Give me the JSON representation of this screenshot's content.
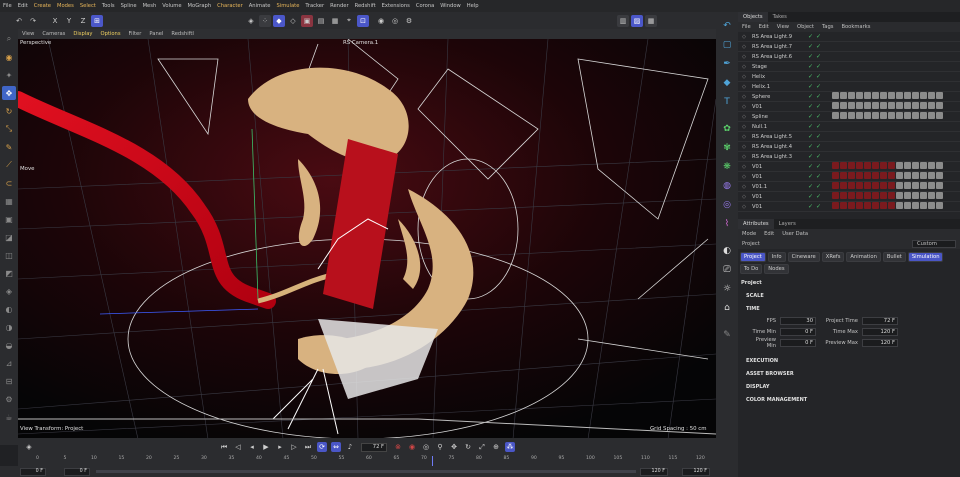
{
  "menu": [
    "File",
    "Edit",
    "Create",
    "Modes",
    "Select",
    "Tools",
    "Spline",
    "Mesh",
    "Volume",
    "MoGraph",
    "Character",
    "Animate",
    "Simulate",
    "Tracker",
    "Render",
    "Redshift",
    "Extensions",
    "Corona",
    "Window",
    "Help"
  ],
  "toolbar": {
    "axis_x": "X",
    "axis_y": "Y",
    "axis_z": "Z"
  },
  "viewport": {
    "menu": [
      "View",
      "Cameras",
      "Display",
      "Options",
      "Filter",
      "Panel",
      "RedshiftI"
    ],
    "title": "Perspective",
    "camera": "RS Camera.1",
    "tool_label": "Move",
    "view_transform": "View Transform: Project",
    "grid_spacing": "Grid Spacing : 50 cm"
  },
  "timeline": {
    "current_frame": "72 F"
  },
  "ruler": {
    "ticks": [
      "0",
      "5",
      "10",
      "15",
      "20",
      "25",
      "30",
      "35",
      "40",
      "45",
      "50",
      "55",
      "60",
      "65",
      "70",
      "75",
      "80",
      "85",
      "90",
      "95",
      "100",
      "105",
      "110",
      "115",
      "120"
    ],
    "cursor_frame": 72
  },
  "range": {
    "start": "0 F",
    "start2": "0 F",
    "end": "120 F",
    "end2": "120 F"
  },
  "objects": {
    "tabs": [
      "Objects",
      "Takes"
    ],
    "menu": [
      "File",
      "Edit",
      "View",
      "Object",
      "Tags",
      "Bookmarks"
    ],
    "rows": [
      {
        "name": "RS Area Light.9"
      },
      {
        "name": "RS Area Light.7"
      },
      {
        "name": "RS Area Light.6"
      },
      {
        "name": "Stage"
      },
      {
        "name": "Helix"
      },
      {
        "name": "Helix.1"
      },
      {
        "name": "Sphere"
      },
      {
        "name": "V01"
      },
      {
        "name": "Spline"
      },
      {
        "name": "Null.1"
      },
      {
        "name": "RS Area Light.5"
      },
      {
        "name": "RS Area Light.4"
      },
      {
        "name": "RS Area Light.3"
      },
      {
        "name": "V01"
      },
      {
        "name": "V01"
      },
      {
        "name": "V01.1"
      },
      {
        "name": "V01"
      },
      {
        "name": "V01"
      }
    ]
  },
  "attributes": {
    "tabs": [
      "Attributes",
      "Layers"
    ],
    "menu": [
      "Mode",
      "Edit",
      "User Data"
    ],
    "object": "Project",
    "preset": "Custom",
    "ptabs": [
      "Project",
      "Info",
      "Cineware",
      "XRefs",
      "Animation",
      "Bullet",
      "Simulation",
      "To Do",
      "Nodes"
    ],
    "heading": "Project",
    "sections": {
      "scale": "SCALE",
      "time": "TIME",
      "execution": "EXECUTION",
      "asset": "ASSET BROWSER",
      "display": "DISPLAY",
      "color": "COLOR MANAGEMENT"
    },
    "fields": {
      "fps_label": "FPS",
      "fps": "30",
      "ptime_label": "Project Time",
      "ptime": "72 F",
      "tmin_label": "Time Min",
      "tmin": "0 F",
      "tmax_label": "Time Max",
      "tmax": "120 F",
      "pmin_label": "Preview Min",
      "pmin": "0 F",
      "pmax_label": "Preview Max",
      "pmax": "120 F"
    }
  }
}
